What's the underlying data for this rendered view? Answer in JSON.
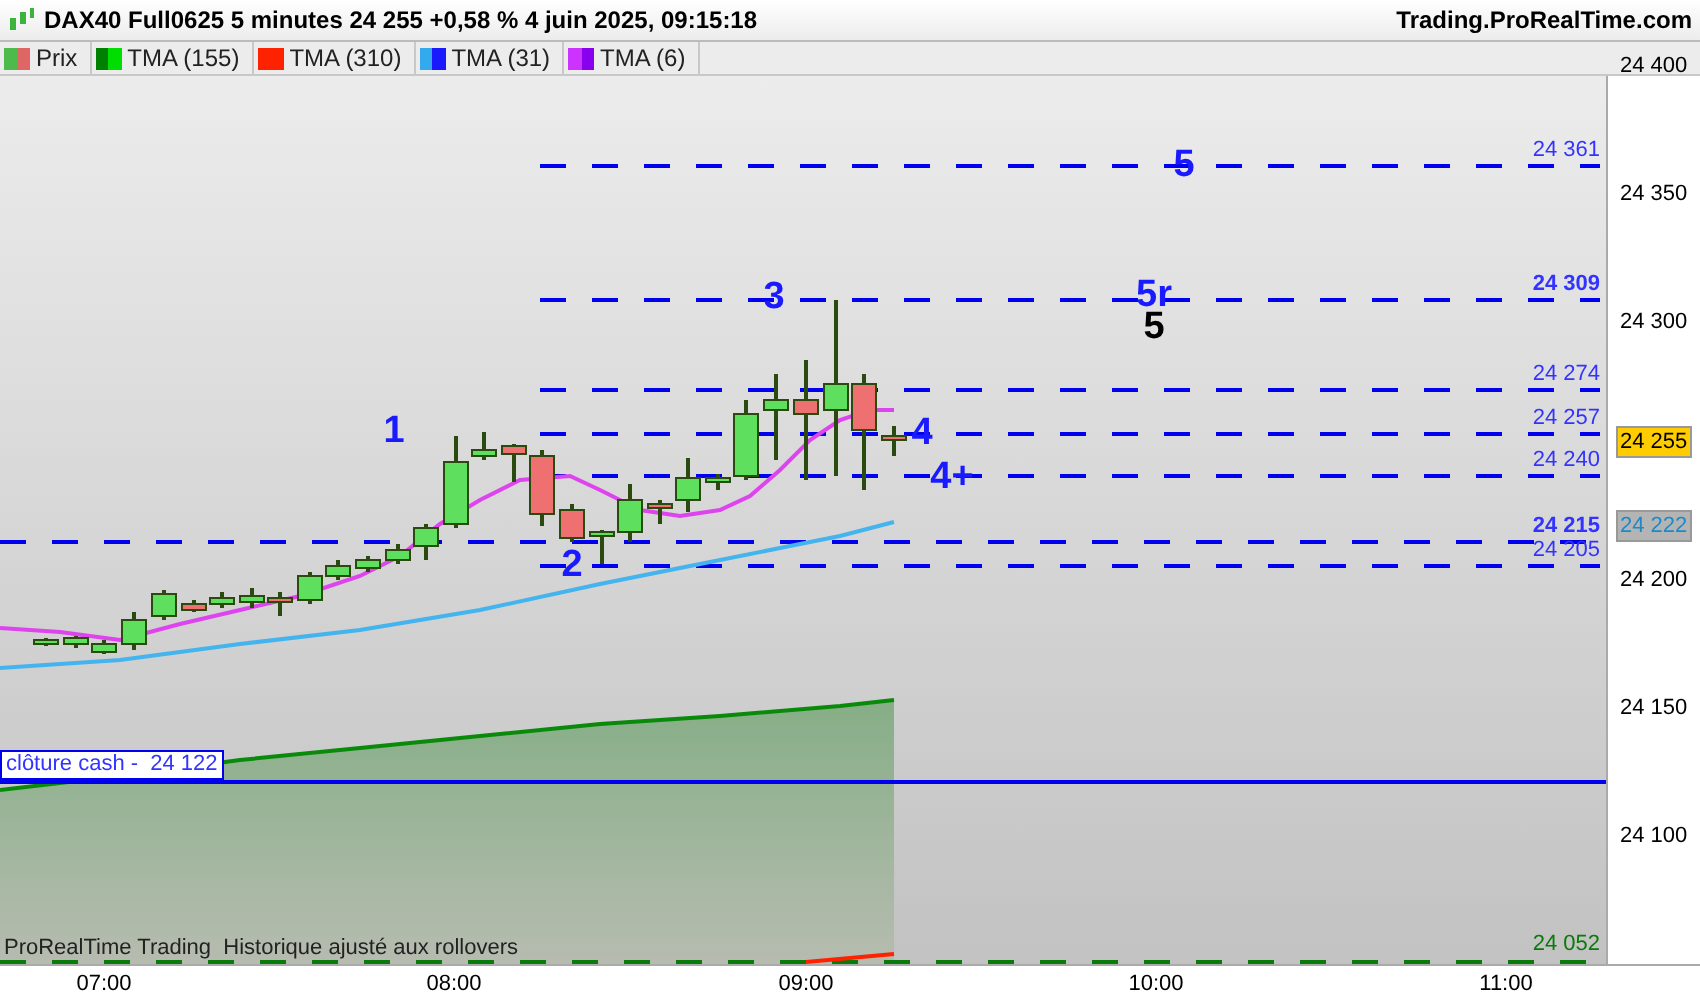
{
  "header": {
    "title": "DAX40 Full0625 5 minutes 24 255 +0,58 % 4 juin 2025, 09:15:18",
    "site": "Trading.ProRealTime.com"
  },
  "legend": [
    {
      "label": "Prix",
      "swatches": [
        {
          "color": "#4cbb4c"
        },
        {
          "color": "#e06666"
        }
      ]
    },
    {
      "label": "TMA (155)",
      "swatches": [
        {
          "color": "#008000"
        },
        {
          "color": "#00dd00"
        }
      ]
    },
    {
      "label": "TMA (310)",
      "swatches": [
        {
          "color": "#ff2200"
        },
        {
          "color": "#ff2200"
        }
      ]
    },
    {
      "label": "TMA (31)",
      "swatches": [
        {
          "color": "#33aaee"
        },
        {
          "color": "#1a1aff"
        }
      ]
    },
    {
      "label": "TMA (6)",
      "swatches": [
        {
          "color": "#cc33ff"
        },
        {
          "color": "#8800ee"
        }
      ]
    }
  ],
  "levels": [
    {
      "label": "24 361",
      "bold": false
    },
    {
      "label": "24 309",
      "bold": true
    },
    {
      "label": "24 274",
      "bold": false
    },
    {
      "label": "24 257",
      "bold": false
    },
    {
      "label": "24 240",
      "bold": false
    },
    {
      "label": "24 215",
      "bold": true
    },
    {
      "label": "24 205",
      "bold": false
    }
  ],
  "wave_labels": [
    {
      "text": "1",
      "color": "#1a1aff"
    },
    {
      "text": "2",
      "color": "#1a1aff"
    },
    {
      "text": "3",
      "color": "#1a1aff"
    },
    {
      "text": "4",
      "color": "#1a1aff"
    },
    {
      "text": "4+",
      "color": "#1a1aff"
    },
    {
      "text": "5",
      "color": "#1a1aff"
    },
    {
      "text": "5r",
      "color": "#1a1aff"
    },
    {
      "text": "5",
      "color": "#000000"
    }
  ],
  "cash_close": {
    "label": "clôture cash -  24 122"
  },
  "volume_level": {
    "label": "24 052"
  },
  "footer_note": "ProRealTime Trading  Historique ajusté aux rollovers",
  "price_axis": [
    "24 400",
    "24 350",
    "24 300",
    "24 200",
    "24 150",
    "24 100"
  ],
  "axis_badges": [
    {
      "label": "24 255",
      "color": "#ffcc00"
    },
    {
      "label": "24 222",
      "color": "#b4b4b4"
    }
  ],
  "time_axis": [
    "07:00",
    "08:00",
    "09:00",
    "10:00",
    "11:00"
  ]
}
